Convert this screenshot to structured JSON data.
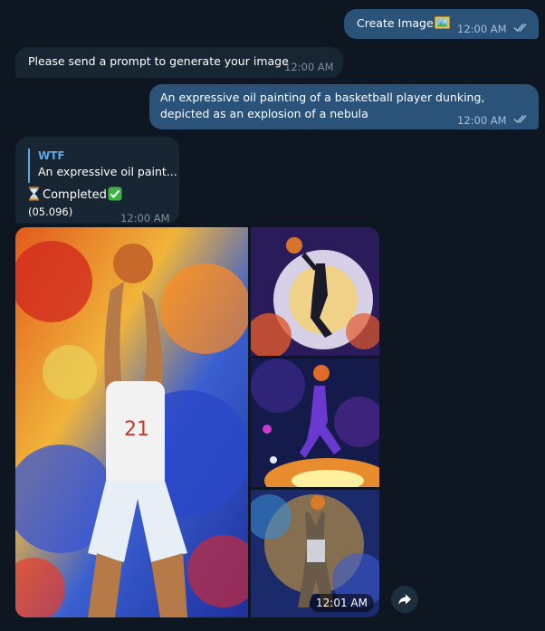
{
  "messages": [
    {
      "text": "Create Image",
      "emoji": "framed-picture-icon",
      "time": "12:00 AM"
    },
    {
      "text": "Please send a prompt to generate your image",
      "time": "12:00 AM"
    },
    {
      "text": "An expressive oil painting of a basketball player dunking, depicted as an explosion of a nebula",
      "time": "12:00 AM"
    },
    {
      "reply_name": "WTF",
      "reply_text": "An expressive oil paint...",
      "status_text": "Completed",
      "status_emoji_before": "hourglass-icon",
      "status_emoji_after": "check-mark-button-icon",
      "duration": "(05.096)",
      "time": "12:00 AM"
    }
  ],
  "album": {
    "time": "12:01 AM",
    "images": [
      "painting-player-dunking-1",
      "painting-player-dunking-2",
      "painting-player-dunking-3",
      "painting-player-dunking-4"
    ]
  },
  "share_icon": "share-arrow-icon",
  "colors": {
    "background": "#0e1621",
    "outgoing_bubble": "#2b5278",
    "incoming_bubble": "#182533",
    "accent": "#5fa8e8"
  }
}
